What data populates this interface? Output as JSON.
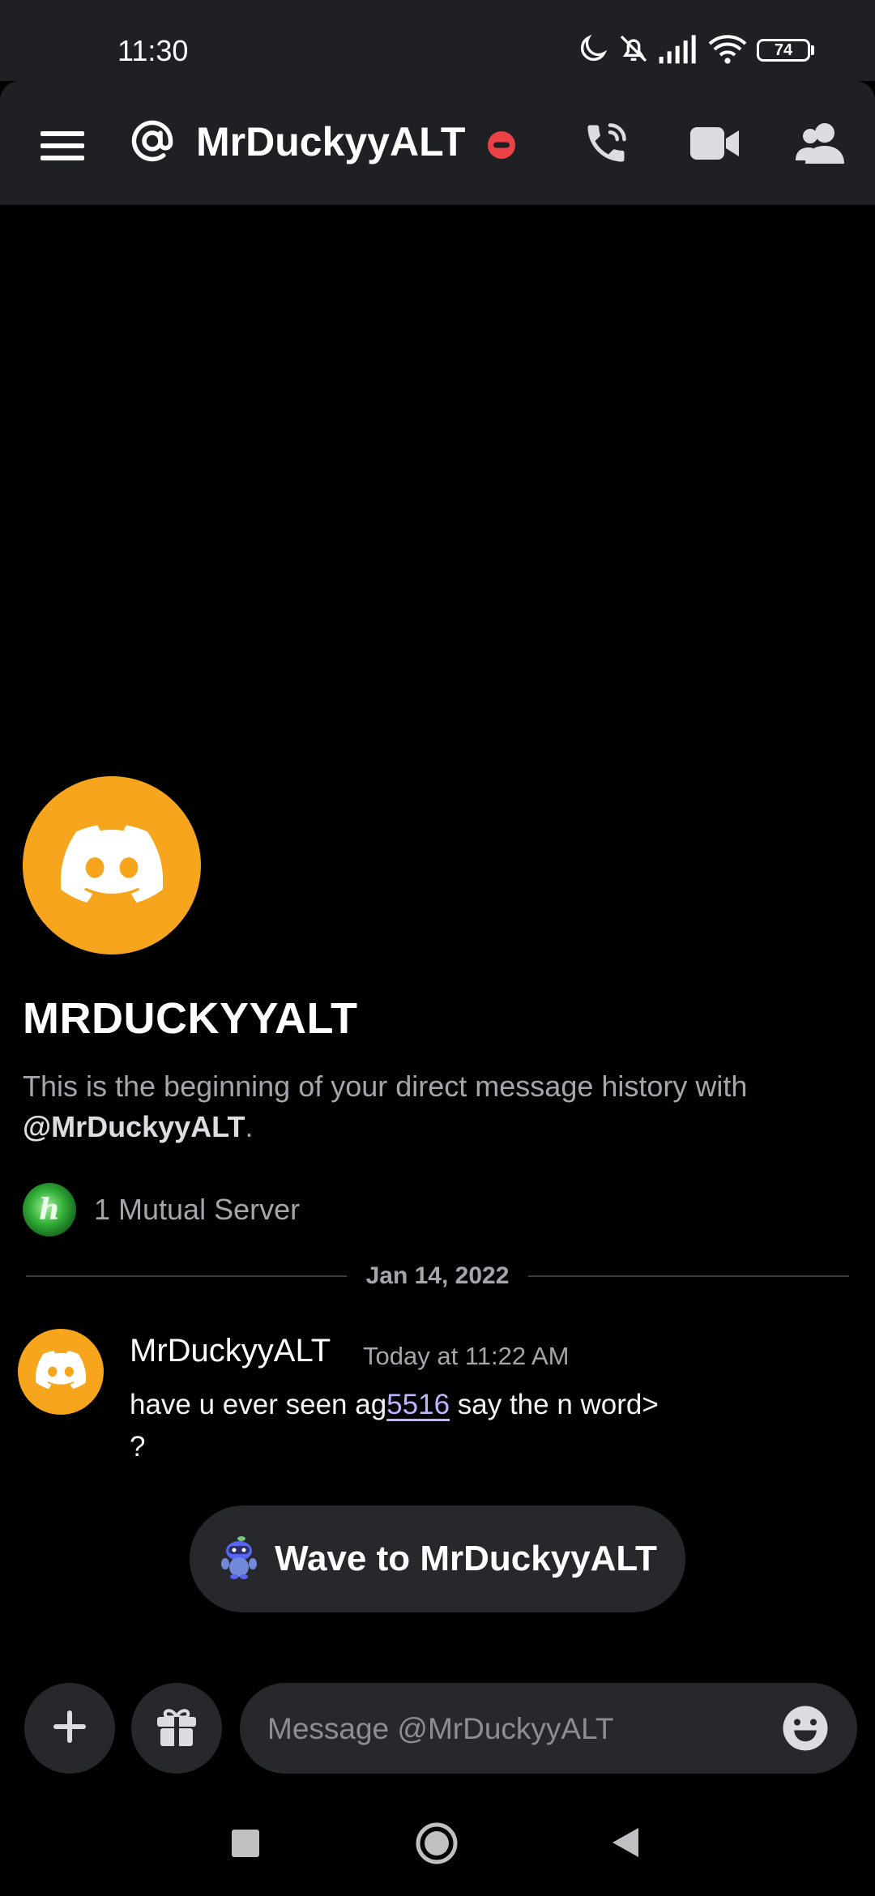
{
  "status_bar": {
    "time": "11:30",
    "battery": "74",
    "icons": [
      "moon-icon",
      "bell-off-icon",
      "signal-icon",
      "wifi-icon",
      "battery-icon"
    ]
  },
  "header": {
    "title": "MrDuckyyALT",
    "icons": [
      "menu-icon",
      "at-icon",
      "dnd-status-icon",
      "voice-call-icon",
      "video-call-icon",
      "members-icon"
    ]
  },
  "intro": {
    "name": "MRDUCKYYALT",
    "description_prefix": "This is the beginning of your direct message history with ",
    "description_handle": "@MrDuckyyALT",
    "description_suffix": ".",
    "mutual_server_initial": "h",
    "mutual_servers": "1 Mutual Server"
  },
  "divider": {
    "date": "Jan 14, 2022"
  },
  "message": {
    "author": "MrDuckyyALT",
    "timestamp": "Today at 11:22 AM",
    "text_before": "have u ever seen ag",
    "link_text": "5516",
    "text_after": " say the n word>",
    "line2": "?"
  },
  "wave_button": {
    "label": "Wave to MrDuckyyALT"
  },
  "composer": {
    "placeholder": "Message @MrDuckyyALT"
  },
  "colors": {
    "background": "#000000",
    "surface": "#1f2023",
    "input": "#27282c",
    "avatar": "#f6a51c",
    "dnd": "#ed4245",
    "link": "#b9b5ff",
    "muted_text": "#a3a6aa"
  }
}
